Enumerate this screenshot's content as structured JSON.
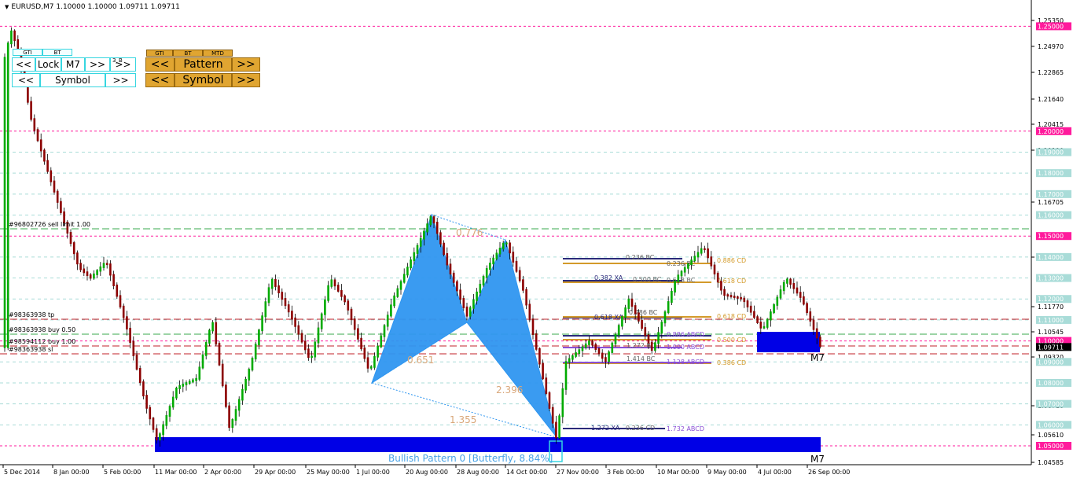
{
  "header": {
    "symbol_line": "EURUSD,M7  1.10000 1.10000 1.09711 1.09711"
  },
  "control_panel_left": {
    "tabs": [
      "GTI",
      "BT"
    ],
    "row1": {
      "prev": "<<",
      "lock": "Lock",
      "timeframe": "M7",
      "next": ">>",
      "small_label": "3_B",
      "extra": ">>"
    },
    "row2": {
      "prev": "<<",
      "symbol": "Symbol",
      "next": ">>"
    }
  },
  "control_panel_right": {
    "tabs": [
      "GTI",
      "BT",
      "MTD"
    ],
    "row1": {
      "prev": "<<",
      "pattern": "Pattern",
      "next": ">>"
    },
    "row2": {
      "prev": "<<",
      "symbol": "Symbol",
      "next": ">>"
    }
  },
  "price_axis": {
    "labels": [
      "1.25350",
      "1.24970",
      "1.22865",
      "1.21640",
      "1.20415",
      "1.19190",
      "1.16705",
      "1.14255",
      "1.11770",
      "1.10545",
      "1.09320",
      "1.06710",
      "1.05610",
      "1.04585"
    ],
    "levels": [
      "1.25000",
      "1.20000",
      "1.19000",
      "1.18000",
      "1.17000",
      "1.16000",
      "1.15000",
      "1.14000",
      "1.13000",
      "1.12000",
      "1.11000",
      "1.10000",
      "1.09000",
      "1.08000",
      "1.07000",
      "1.06000",
      "1.05000"
    ],
    "current_price": "1.09711"
  },
  "time_axis": {
    "labels": [
      "5 Dec 2014",
      "8 Jan 00:00",
      "5 Feb 00:00",
      "11 Mar 00:00",
      "2 Apr 00:00",
      "29 Apr 00:00",
      "25 May 00:00",
      "1 Jul 00:00",
      "20 Aug 00:00",
      "28 Aug 00:00",
      "14 Oct 00:00",
      "27 Nov 00:00",
      "3 Feb 00:00",
      "10 Mar 00:00",
      "9 May 00:00",
      "4 Jul 00:00",
      "26 Sep 00:00"
    ]
  },
  "order_labels": [
    "#96802726 sell limit 1.00",
    "#98363938 tp",
    "#98363938 buy 0.50",
    "#98594112 buy 1.00",
    "#98363938 sl"
  ],
  "pattern": {
    "ratios": [
      "0.776",
      "0.651",
      "2.396",
      "1.355"
    ],
    "caption": "Bullish Pattern 0  [Butterfly,  8.84%]",
    "colors": {
      "fill": "#2f96f0",
      "zone": "#0000e6",
      "ratio_text": "#d9a77a",
      "caption": "#4aa3e6"
    }
  },
  "fib_labels": [
    "0.236 BC",
    "0.382 XA",
    "0.500 BC",
    "0.618 XA",
    "0.886 ABCD",
    "1.000 ABCD",
    "1.414 BC",
    "1.128 ABCD",
    "1.272 XA",
    "1.732 ABCD",
    "0.886 CD",
    "0.618 CD",
    "0.500 CD",
    "0.386 CD",
    "0.236 BC",
    "0.618 BC",
    "0.786 BC",
    "1.272 BC",
    "0.618 CD",
    "0.236 CD"
  ],
  "timeframe_tags": [
    "M7",
    "M7"
  ],
  "colors": {
    "bull": "#00aa00",
    "bear": "#8b0000",
    "magenta": "#ff1a9c",
    "dash_green": "#3aa84e",
    "dash_red": "#c0202a",
    "grid_teal": "#a9dcd8",
    "fib_gold": "#d39a2a",
    "fib_violet": "#8a4fd6",
    "fib_navy": "#2a2a7a"
  }
}
